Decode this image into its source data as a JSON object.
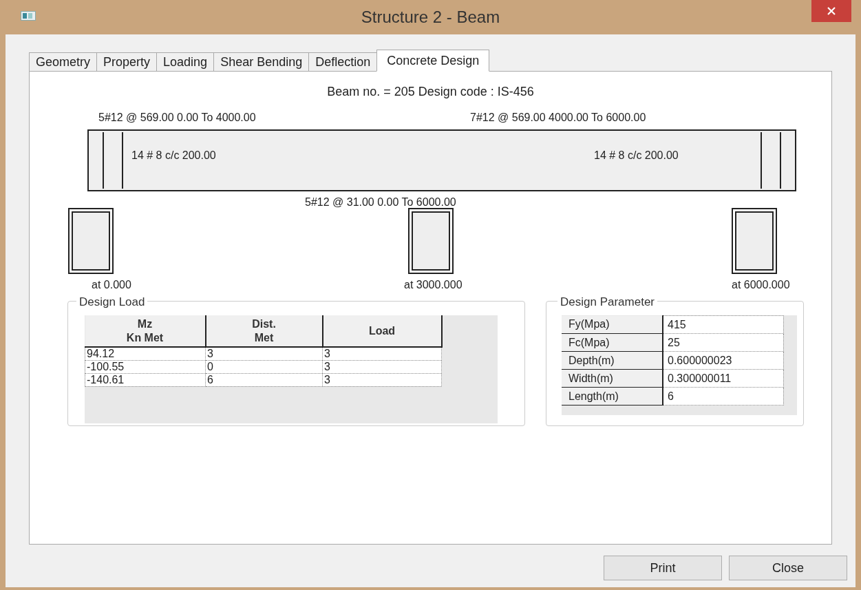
{
  "window": {
    "title": "Structure 2 - Beam"
  },
  "tabs": [
    {
      "label": "Geometry",
      "selected": false
    },
    {
      "label": "Property",
      "selected": false
    },
    {
      "label": "Loading",
      "selected": false
    },
    {
      "label": "Shear Bending",
      "selected": false
    },
    {
      "label": "Deflection",
      "selected": false
    },
    {
      "label": "Concrete Design",
      "selected": true
    }
  ],
  "heading": "Beam no. = 205  Design code :  IS-456",
  "beam": {
    "top_left": "5#12 @ 569.00 0.00 To 4000.00",
    "top_right": "7#12 @ 569.00 4000.00 To 6000.00",
    "stirrups_left": "14 # 8 c/c 200.00",
    "stirrups_right": "14 # 8 c/c 200.00",
    "bottom": "5#12 @ 31.00 0.00 To 6000.00"
  },
  "sections": [
    "at 0.000",
    "at 3000.000",
    "at 6000.000"
  ],
  "design_load": {
    "title": "Design Load",
    "columns": [
      "Mz\nKn Met",
      "Dist.\nMet",
      "Load"
    ],
    "rows": [
      [
        "94.12",
        "3",
        "3"
      ],
      [
        "-100.55",
        "0",
        "3"
      ],
      [
        "-140.61",
        "6",
        "3"
      ]
    ]
  },
  "design_parameter": {
    "title": "Design Parameter",
    "rows": [
      [
        "Fy(Mpa)",
        "415"
      ],
      [
        "Fc(Mpa)",
        "25"
      ],
      [
        "Depth(m)",
        "0.600000023"
      ],
      [
        "Width(m)",
        "0.300000011"
      ],
      [
        "Length(m)",
        "6"
      ]
    ]
  },
  "buttons": [
    "Print",
    "Close"
  ]
}
